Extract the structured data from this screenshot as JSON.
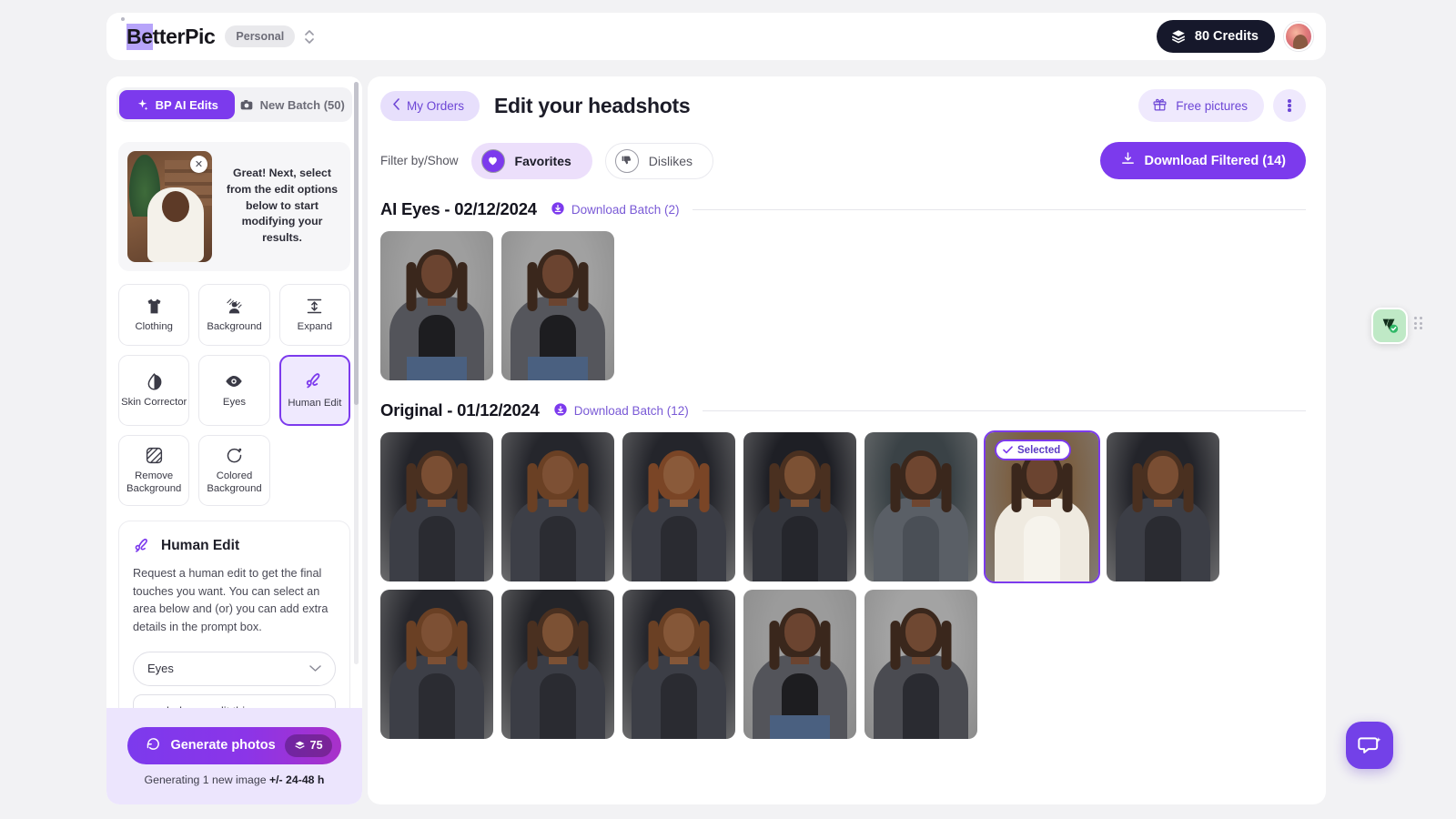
{
  "topbar": {
    "logo_highlight": "Be",
    "logo_rest": "tterPic",
    "workspace_badge": "Personal",
    "credits_label": "80 Credits",
    "credits_icon": "layers-icon",
    "workspace_switch_icon": "chevron-up-down-icon",
    "avatar_name": "user-avatar"
  },
  "sidebar": {
    "tabs": [
      {
        "label": "BP AI Edits",
        "icon": "sparkle-icon",
        "active": true
      },
      {
        "label": "New Batch (50)",
        "icon": "camera-icon",
        "active": false
      }
    ],
    "notice": {
      "text": "Great! Next, select from the edit options below to start modifying your results.",
      "close_icon": "close-icon"
    },
    "options": [
      {
        "label": "Clothing",
        "icon": "tshirt-icon",
        "active": false
      },
      {
        "label": "Background",
        "icon": "portrait-background-icon",
        "active": false
      },
      {
        "label": "Expand",
        "icon": "expand-vertical-icon",
        "active": false
      },
      {
        "label": "Skin Corrector",
        "icon": "droplet-contrast-icon",
        "active": false
      },
      {
        "label": "Eyes",
        "icon": "eye-icon",
        "active": false
      },
      {
        "label": "Human Edit",
        "icon": "scribble-icon",
        "active": true
      },
      {
        "label": "Remove Background",
        "icon": "crossed-frame-icon",
        "active": false
      },
      {
        "label": "Colored Background",
        "icon": "color-circle-icon",
        "active": false
      }
    ],
    "human_edit": {
      "title": "Human Edit",
      "icon": "scribble-icon",
      "description": "Request a human edit to get the final touches you want. You can select an area below and (or) you can add extra details in the prompt box.",
      "area_select_value": "Eyes",
      "area_select_chevron": "chevron-down-icon",
      "prompt_value": "you help me edit this so my eyes look straight like I am steering straight into the"
    },
    "generate": {
      "button_label": "Generate photos",
      "button_icon": "refresh-icon",
      "credit_cost": "75",
      "credit_icon": "layers-icon",
      "note_prefix": "Generating 1 new image ",
      "note_bold": "+/- 24-48 h"
    }
  },
  "main": {
    "back_label": "My Orders",
    "back_icon": "chevron-left-icon",
    "title": "Edit your headshots",
    "free_pictures_label": "Free pictures",
    "free_pictures_icon": "gift-icon",
    "more_menu_icon": "kebab-menu-icon",
    "filter": {
      "label": "Filter by/Show",
      "chips": [
        {
          "label": "Favorites",
          "icon": "heart-icon",
          "active": true
        },
        {
          "label": "Dislikes",
          "icon": "thumbs-down-icon",
          "active": false
        }
      ]
    },
    "download_filtered": {
      "label": "Download Filtered (14)",
      "icon": "download-icon"
    },
    "sections": [
      {
        "title": "AI Eyes - 02/12/2024",
        "batch_label": "Download Batch (2)",
        "batch_icon": "download-circle-icon",
        "photos": [
          {
            "name": "headshot-gray-bg-1",
            "bg": "#9e9e9e",
            "suit": "#53545a",
            "inner": "#1d1d20",
            "skin": "#6b4430",
            "hair": "#3a271c",
            "jeans": "#4a6080",
            "selected": false
          },
          {
            "name": "headshot-gray-bg-2",
            "bg": "#a1a1a1",
            "suit": "#55565c",
            "inner": "#1d1d20",
            "skin": "#6b4430",
            "hair": "#3a271c",
            "jeans": "#4a6080",
            "selected": false
          }
        ]
      },
      {
        "title": "Original - 01/12/2024",
        "batch_label": "Download Batch (12)",
        "batch_icon": "download-circle-icon",
        "photos": [
          {
            "name": "headshot-dark-bg-1",
            "bg": "#23242a",
            "suit": "#3c3e46",
            "inner": "#2a2b31",
            "skin": "#7a4e33",
            "hair": "#4a3020",
            "jeans": "",
            "selected": false
          },
          {
            "name": "headshot-dark-bg-2",
            "bg": "#25262c",
            "suit": "#3d3f47",
            "inner": "#2b2c32",
            "skin": "#7d5034",
            "hair": "#6a4024",
            "jeans": "",
            "selected": false
          },
          {
            "name": "headshot-dark-bg-3",
            "bg": "#24252b",
            "suit": "#3b3d45",
            "inner": "#2a2b31",
            "skin": "#8a5a3a",
            "hair": "#7a4526",
            "jeans": "",
            "selected": false
          },
          {
            "name": "headshot-dark-bg-4",
            "bg": "#1e1f25",
            "suit": "#34363d",
            "inner": "#25262c",
            "skin": "#7c5134",
            "hair": "#4a3020",
            "jeans": "",
            "selected": false
          },
          {
            "name": "headshot-teal-bg-5",
            "bg": "#3a4246",
            "suit": "#5a5f66",
            "inner": "#4a4f56",
            "skin": "#6f4630",
            "hair": "#3a271c",
            "jeans": "",
            "selected": false
          },
          {
            "name": "headshot-office-bg-6",
            "bg": "#7b6044",
            "suit": "#efeae0",
            "inner": "#f6f3ec",
            "skin": "#6b4430",
            "hair": "#3a271c",
            "jeans": "",
            "selected": true
          },
          {
            "name": "headshot-dark-bg-7",
            "bg": "#23242a",
            "suit": "#3c3e46",
            "inner": "#2a2b31",
            "skin": "#7a4e33",
            "hair": "#4a3020",
            "jeans": "",
            "selected": false
          },
          {
            "name": "headshot-dark-bg-8",
            "bg": "#25262c",
            "suit": "#3d3f47",
            "inner": "#2b2c32",
            "skin": "#7d5034",
            "hair": "#6a4024",
            "jeans": "",
            "selected": false
          },
          {
            "name": "headshot-dark-bg-9",
            "bg": "#232429",
            "suit": "#3b3d45",
            "inner": "#2a2b31",
            "skin": "#7c5134",
            "hair": "#4a3020",
            "jeans": "",
            "selected": false
          },
          {
            "name": "headshot-dark-bg-10",
            "bg": "#24252b",
            "suit": "#3c3e46",
            "inner": "#2a2b31",
            "skin": "#855738",
            "hair": "#6a4024",
            "jeans": "",
            "selected": false
          },
          {
            "name": "headshot-gray-bg-11",
            "bg": "#9b9b9b",
            "suit": "#53545a",
            "inner": "#1d1d20",
            "skin": "#6b4430",
            "hair": "#3a271c",
            "jeans": "#4a6080",
            "selected": false
          },
          {
            "name": "headshot-gray-bg-12",
            "bg": "#a3a3a3",
            "suit": "#4a4b51",
            "inner": "#2a2b31",
            "skin": "#6f4832",
            "hair": "#3a271c",
            "jeans": "",
            "selected": false
          }
        ]
      }
    ],
    "selected_badge_label": "Selected",
    "selected_badge_icon": "check-icon"
  },
  "floating": {
    "grammarly_icon": "grammarly-icon",
    "drag_handle_icon": "drag-dots-icon",
    "chat_icon": "chat-bubble-sparkle-icon"
  },
  "colors": {
    "accent": "#7c3aed",
    "accent_light": "#efe9fd",
    "dark": "#16182b",
    "page_bg": "#f2f2f4"
  }
}
